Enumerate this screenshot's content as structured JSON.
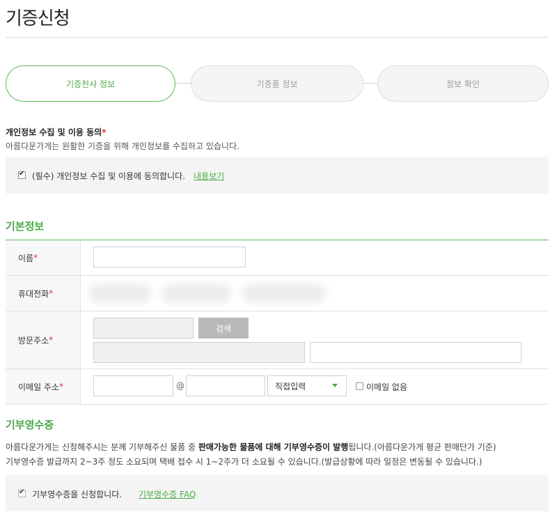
{
  "page": {
    "title": "기증신청"
  },
  "steps": [
    {
      "label": "기증천사 정보",
      "active": true
    },
    {
      "label": "기증품 정보",
      "active": false
    },
    {
      "label": "정보 확인",
      "active": false
    }
  ],
  "agreement": {
    "title": "개인정보 수집 및 이용 동의",
    "required_mark": "*",
    "description": "아름다운가게는 원활한 기증을 위해 개인정보를 수집하고 있습니다.",
    "checkbox_label": "(필수) 개인정보 수집 및 이용에 동의합니다.",
    "checked": true,
    "link_label": "내용보기"
  },
  "basic_info": {
    "section_title": "기본정보",
    "name": {
      "label": "이름",
      "required_mark": "*",
      "value": ""
    },
    "phone": {
      "label": "휴대전화",
      "required_mark": "*"
    },
    "address": {
      "label": "방문주소",
      "required_mark": "*",
      "search_button": "검색",
      "postcode_value": "",
      "address_value": "",
      "detail_value": ""
    },
    "email": {
      "label": "이메일 주소",
      "required_mark": "*",
      "id_value": "",
      "at_symbol": "@",
      "domain_value": "",
      "domain_select": "직접입력",
      "no_email_label": "이메일 없음",
      "no_email_checked": false
    }
  },
  "receipt": {
    "section_title": "기부영수증",
    "desc_line1_prefix": "아름다운가게는 신청해주시는 분께 기부해주신 물품 중 ",
    "desc_line1_bold": "판매가능한 물품에 대해 기부영수증이 발행",
    "desc_line1_suffix": "됩니다.(아름다운가게 평균 판매단가 기준)",
    "desc_line2": "기부영수증 발급까지 2~3주 정도 소요되며 택배 접수 시 1~2주가 더 소요될 수 있습니다.(발급상황에 따라 일정은 변동될 수 있습니다.)",
    "checkbox_label": "기부영수증을 신청합니다.",
    "checked": true,
    "link_label": "기부영수증 FAQ"
  },
  "colors": {
    "accent": "#4aa84a",
    "required": "#dd3333"
  }
}
